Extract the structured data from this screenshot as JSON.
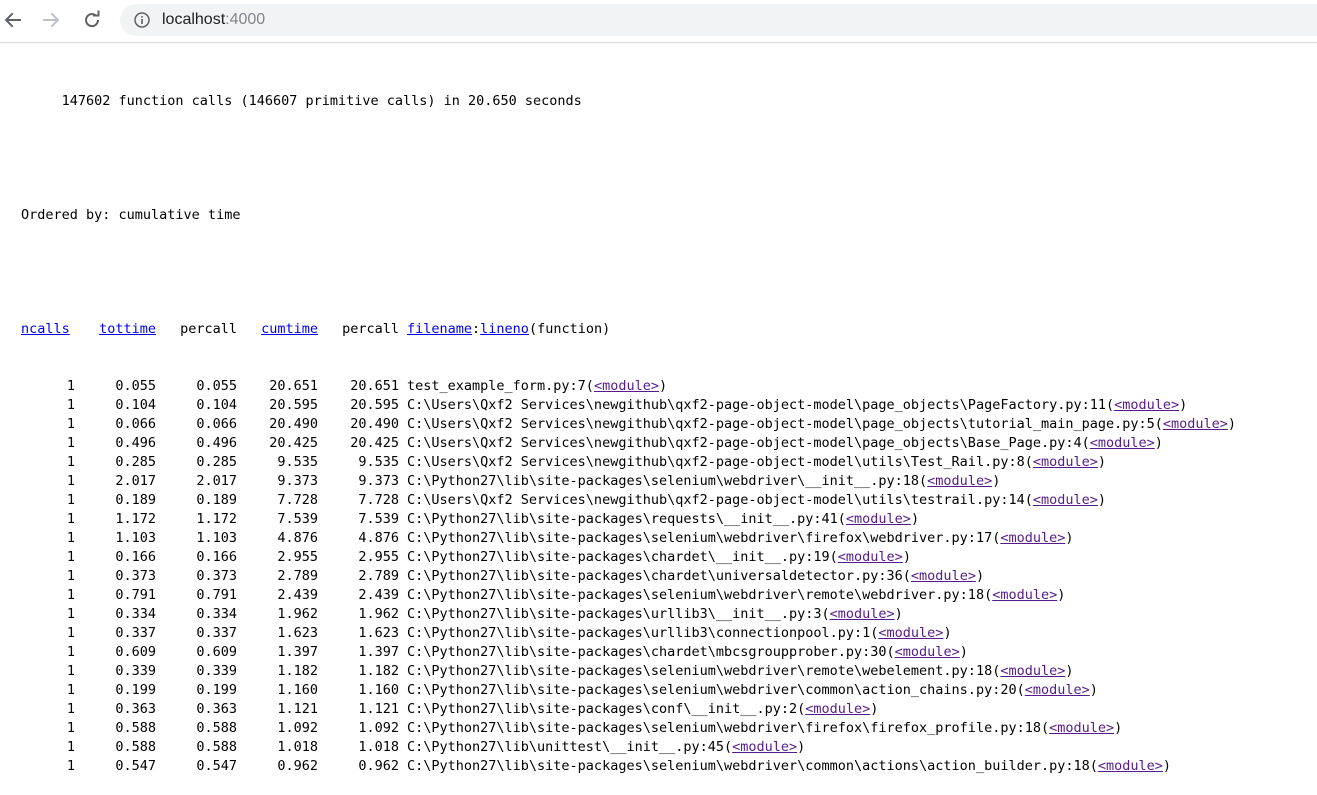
{
  "browser": {
    "url_host": "localhost",
    "url_port": ":4000"
  },
  "summary": "     147602 function calls (146607 primitive calls) in 20.650 seconds",
  "ordered_by": "Ordered by: cumulative time",
  "headers": {
    "ncalls": "ncalls",
    "tottime": "tottime",
    "percall1": "percall",
    "cumtime": "cumtime",
    "percall2": "percall",
    "filename": "filename",
    "colon": ":",
    "lineno": "lineno",
    "function": "(function)"
  },
  "rows": [
    {
      "ncalls": "1",
      "tottime": "0.055",
      "percall1": "0.055",
      "cumtime": "20.651",
      "percall2": "20.651",
      "file": "test_example_form.py:7(",
      "func": "<module>",
      "close": ")"
    },
    {
      "ncalls": "1",
      "tottime": "0.104",
      "percall1": "0.104",
      "cumtime": "20.595",
      "percall2": "20.595",
      "file": "C:\\Users\\Qxf2 Services\\newgithub\\qxf2-page-object-model\\page_objects\\PageFactory.py:11(",
      "func": "<module>",
      "close": ")"
    },
    {
      "ncalls": "1",
      "tottime": "0.066",
      "percall1": "0.066",
      "cumtime": "20.490",
      "percall2": "20.490",
      "file": "C:\\Users\\Qxf2 Services\\newgithub\\qxf2-page-object-model\\page_objects\\tutorial_main_page.py:5(",
      "func": "<module>",
      "close": ")"
    },
    {
      "ncalls": "1",
      "tottime": "0.496",
      "percall1": "0.496",
      "cumtime": "20.425",
      "percall2": "20.425",
      "file": "C:\\Users\\Qxf2 Services\\newgithub\\qxf2-page-object-model\\page_objects\\Base_Page.py:4(",
      "func": "<module>",
      "close": ")"
    },
    {
      "ncalls": "1",
      "tottime": "0.285",
      "percall1": "0.285",
      "cumtime": "9.535",
      "percall2": "9.535",
      "file": "C:\\Users\\Qxf2 Services\\newgithub\\qxf2-page-object-model\\utils\\Test_Rail.py:8(",
      "func": "<module>",
      "close": ")"
    },
    {
      "ncalls": "1",
      "tottime": "2.017",
      "percall1": "2.017",
      "cumtime": "9.373",
      "percall2": "9.373",
      "file": "C:\\Python27\\lib\\site-packages\\selenium\\webdriver\\__init__.py:18(",
      "func": "<module>",
      "close": ")"
    },
    {
      "ncalls": "1",
      "tottime": "0.189",
      "percall1": "0.189",
      "cumtime": "7.728",
      "percall2": "7.728",
      "file": "C:\\Users\\Qxf2 Services\\newgithub\\qxf2-page-object-model\\utils\\testrail.py:14(",
      "func": "<module>",
      "close": ")"
    },
    {
      "ncalls": "1",
      "tottime": "1.172",
      "percall1": "1.172",
      "cumtime": "7.539",
      "percall2": "7.539",
      "file": "C:\\Python27\\lib\\site-packages\\requests\\__init__.py:41(",
      "func": "<module>",
      "close": ")"
    },
    {
      "ncalls": "1",
      "tottime": "1.103",
      "percall1": "1.103",
      "cumtime": "4.876",
      "percall2": "4.876",
      "file": "C:\\Python27\\lib\\site-packages\\selenium\\webdriver\\firefox\\webdriver.py:17(",
      "func": "<module>",
      "close": ")"
    },
    {
      "ncalls": "1",
      "tottime": "0.166",
      "percall1": "0.166",
      "cumtime": "2.955",
      "percall2": "2.955",
      "file": "C:\\Python27\\lib\\site-packages\\chardet\\__init__.py:19(",
      "func": "<module>",
      "close": ")"
    },
    {
      "ncalls": "1",
      "tottime": "0.373",
      "percall1": "0.373",
      "cumtime": "2.789",
      "percall2": "2.789",
      "file": "C:\\Python27\\lib\\site-packages\\chardet\\universaldetector.py:36(",
      "func": "<module>",
      "close": ")"
    },
    {
      "ncalls": "1",
      "tottime": "0.791",
      "percall1": "0.791",
      "cumtime": "2.439",
      "percall2": "2.439",
      "file": "C:\\Python27\\lib\\site-packages\\selenium\\webdriver\\remote\\webdriver.py:18(",
      "func": "<module>",
      "close": ")"
    },
    {
      "ncalls": "1",
      "tottime": "0.334",
      "percall1": "0.334",
      "cumtime": "1.962",
      "percall2": "1.962",
      "file": "C:\\Python27\\lib\\site-packages\\urllib3\\__init__.py:3(",
      "func": "<module>",
      "close": ")"
    },
    {
      "ncalls": "1",
      "tottime": "0.337",
      "percall1": "0.337",
      "cumtime": "1.623",
      "percall2": "1.623",
      "file": "C:\\Python27\\lib\\site-packages\\urllib3\\connectionpool.py:1(",
      "func": "<module>",
      "close": ")"
    },
    {
      "ncalls": "1",
      "tottime": "0.609",
      "percall1": "0.609",
      "cumtime": "1.397",
      "percall2": "1.397",
      "file": "C:\\Python27\\lib\\site-packages\\chardet\\mbcsgroupprober.py:30(",
      "func": "<module>",
      "close": ")"
    },
    {
      "ncalls": "1",
      "tottime": "0.339",
      "percall1": "0.339",
      "cumtime": "1.182",
      "percall2": "1.182",
      "file": "C:\\Python27\\lib\\site-packages\\selenium\\webdriver\\remote\\webelement.py:18(",
      "func": "<module>",
      "close": ")"
    },
    {
      "ncalls": "1",
      "tottime": "0.199",
      "percall1": "0.199",
      "cumtime": "1.160",
      "percall2": "1.160",
      "file": "C:\\Python27\\lib\\site-packages\\selenium\\webdriver\\common\\action_chains.py:20(",
      "func": "<module>",
      "close": ")"
    },
    {
      "ncalls": "1",
      "tottime": "0.363",
      "percall1": "0.363",
      "cumtime": "1.121",
      "percall2": "1.121",
      "file": "C:\\Python27\\lib\\site-packages\\conf\\__init__.py:2(",
      "func": "<module>",
      "close": ")"
    },
    {
      "ncalls": "1",
      "tottime": "0.588",
      "percall1": "0.588",
      "cumtime": "1.092",
      "percall2": "1.092",
      "file": "C:\\Python27\\lib\\site-packages\\selenium\\webdriver\\firefox\\firefox_profile.py:18(",
      "func": "<module>",
      "close": ")"
    },
    {
      "ncalls": "1",
      "tottime": "0.588",
      "percall1": "0.588",
      "cumtime": "1.018",
      "percall2": "1.018",
      "file": "C:\\Python27\\lib\\unittest\\__init__.py:45(",
      "func": "<module>",
      "close": ")"
    },
    {
      "ncalls": "1",
      "tottime": "0.547",
      "percall1": "0.547",
      "cumtime": "0.962",
      "percall2": "0.962",
      "file": "C:\\Python27\\lib\\site-packages\\selenium\\webdriver\\common\\actions\\action_builder.py:18(",
      "func": "<module>",
      "close": ")"
    }
  ]
}
